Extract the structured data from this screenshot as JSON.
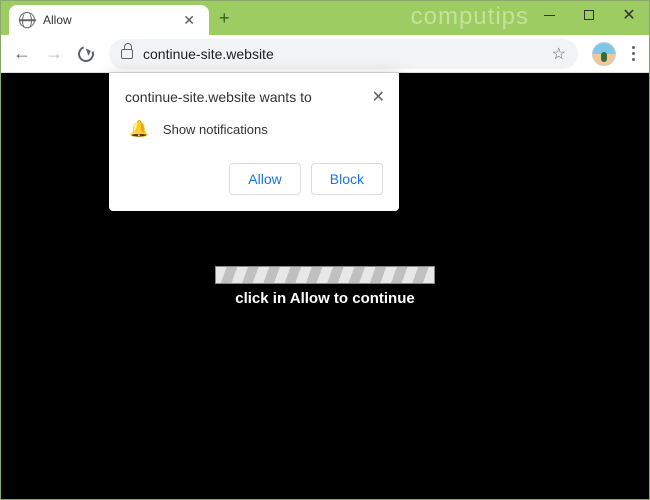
{
  "window": {
    "watermark": "computips"
  },
  "tab": {
    "title": "Allow"
  },
  "toolbar": {
    "url": "continue-site.website"
  },
  "permission": {
    "host_wants": "continue-site.website wants to",
    "item_label": "Show notifications",
    "allow_label": "Allow",
    "block_label": "Block"
  },
  "page": {
    "message_prefix": "click in ",
    "message_bold": "Allow",
    "message_suffix": " to continue"
  }
}
